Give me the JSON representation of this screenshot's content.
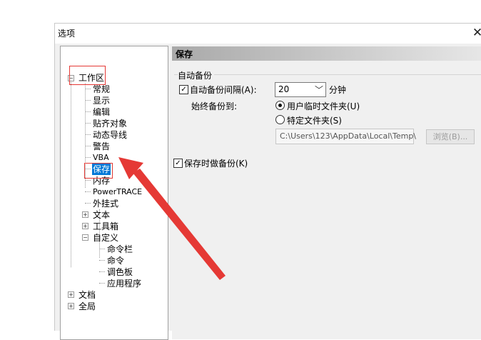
{
  "window": {
    "title": "选项",
    "close_symbol": "✕"
  },
  "tree": {
    "items": [
      {
        "label": "工作区",
        "expander": "−"
      },
      {
        "label": "常规"
      },
      {
        "label": "显示"
      },
      {
        "label": "编辑"
      },
      {
        "label": "贴齐对象"
      },
      {
        "label": "动态导线"
      },
      {
        "label": "警告"
      },
      {
        "label": "VBA"
      },
      {
        "label": "保存"
      },
      {
        "label": "内存"
      },
      {
        "label": "PowerTRACE"
      },
      {
        "label": "外挂式"
      },
      {
        "label": "文本",
        "expander": "+"
      },
      {
        "label": "工具箱",
        "expander": "+"
      },
      {
        "label": "自定义",
        "expander": "−"
      },
      {
        "label": "命令栏"
      },
      {
        "label": "命令"
      },
      {
        "label": "调色板"
      },
      {
        "label": "应用程序"
      },
      {
        "label": "文档",
        "expander": "+"
      },
      {
        "label": "全局",
        "expander": "+"
      }
    ]
  },
  "panel": {
    "title": "保存",
    "group_label": "自动备份",
    "auto_backup_interval": {
      "label": "自动备份间隔(A):",
      "checked": true,
      "value": "20",
      "unit": "分钟"
    },
    "always_backup_to": "始终备份到:",
    "radio_user_temp": "用户临时文件夹(U)",
    "radio_specific": "特定文件夹(S)",
    "folder_path": "C:\\Users\\123\\AppData\\Local\\Temp\\",
    "browse_label": "浏览(B)...",
    "backup_on_save": {
      "label": "保存时做备份(K)",
      "checked": true
    }
  },
  "colors": {
    "annotation": "#e53935",
    "selection": "#0078d7"
  }
}
